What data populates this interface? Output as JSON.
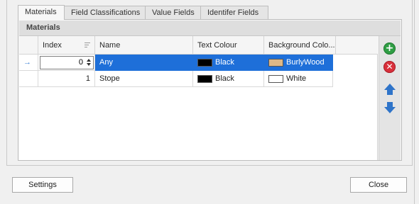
{
  "tabs": [
    {
      "label": "Materials",
      "active": true
    },
    {
      "label": "Field Classifications",
      "active": false
    },
    {
      "label": "Value Fields",
      "active": false
    },
    {
      "label": "Identifer Fields",
      "active": false
    }
  ],
  "group": {
    "title": "Materials"
  },
  "grid": {
    "columns": [
      "Index",
      "Name",
      "Text Colour",
      "Background Colo..."
    ],
    "rows": [
      {
        "selected": true,
        "index": "0",
        "name": "Any",
        "text_colour": {
          "name": "Black",
          "hex": "#000000"
        },
        "background_colour": {
          "name": "BurlyWood",
          "hex": "#deb887"
        }
      },
      {
        "selected": false,
        "index": "1",
        "name": "Stope",
        "text_colour": {
          "name": "Black",
          "hex": "#000000"
        },
        "background_colour": {
          "name": "White",
          "hex": "#ffffff"
        }
      }
    ]
  },
  "toolbar": {
    "add_icon": "plus-circle-green",
    "delete_icon": "x-circle-red",
    "move_up_icon": "arrow-up-blue",
    "move_down_icon": "arrow-down-blue"
  },
  "buttons": {
    "settings": "Settings",
    "close": "Close"
  },
  "colors": {
    "selection": "#1e6fd9",
    "accent": "#2f74c9"
  }
}
